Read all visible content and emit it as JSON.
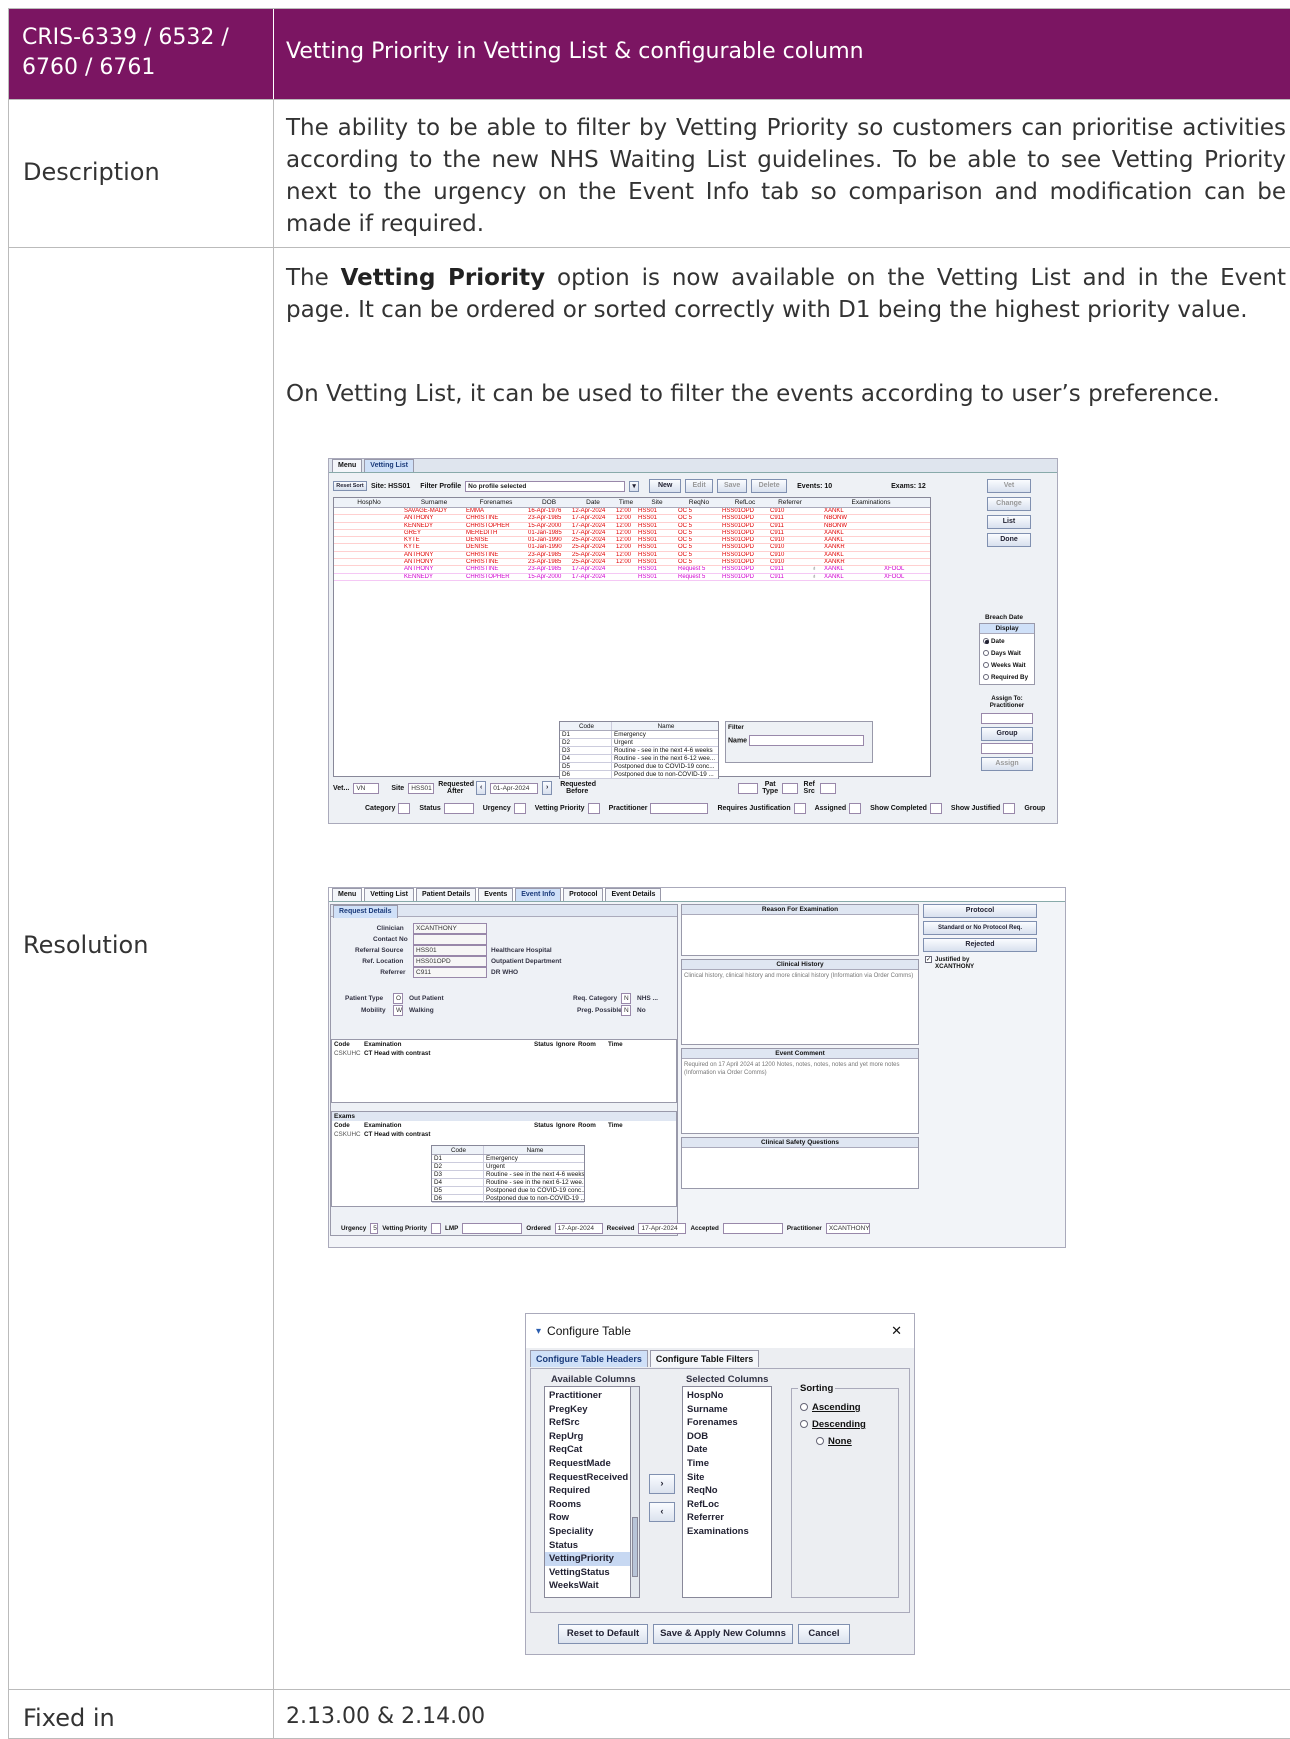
{
  "header": {
    "id": "CRIS-6339 / 6532 / 6760 / 6761",
    "title": "Vetting Priority in Vetting List & configurable column"
  },
  "description": {
    "label": "Description",
    "text": "The ability to be able to filter by Vetting Priority so customers can prioritise activities according to the new NHS Waiting List guidelines. To be able to see Vetting Priority next to the urgency on the Event Info tab so comparison and modification can be made if required."
  },
  "resolution": {
    "label": "Resolution",
    "p1_pre": "The ",
    "p1_bold": "Vetting Priority",
    "p1_post": " option is now available on the Vetting List and in the Event page. It can be ordered or sorted correctly with D1 being the highest priority value.",
    "p2": "On Vetting List, it can be used to filter the events according to user’s preference."
  },
  "fixed": {
    "label": "Fixed in",
    "value": "2.13.00 & 2.14.00"
  },
  "vetting_screen": {
    "tabs": [
      "Menu",
      "Vetting List"
    ],
    "reset_sort": "Reset Sort",
    "site_label": "Site: HSS01",
    "filter_profile_label": "Filter Profile",
    "filter_profile_value": "No profile selected",
    "buttons": [
      "New",
      "Edit",
      "Save",
      "Delete"
    ],
    "events": "Events: 10",
    "exams": "Exams: 12",
    "side_buttons": [
      "Vet",
      "Change",
      "List",
      "Done"
    ],
    "columns": [
      "HospNo",
      "Surname",
      "Forenames",
      "DOB",
      "Date",
      "Time",
      "Site",
      "ReqNo",
      "RefLoc",
      "Referrer",
      "Examinations"
    ],
    "rows": [
      [
        "",
        "SAVAGE-MADY",
        "EMMA",
        "16-Apr-1976",
        "12-Apr-2024",
        "12:00",
        "HSS01",
        "OC 5",
        "HSS01OPD",
        "C910",
        "",
        "XANKL",
        "",
        "r"
      ],
      [
        "",
        "ANTHONY",
        "CHRISTINE",
        "23-Apr-1985",
        "17-Apr-2024",
        "12:00",
        "HSS01",
        "OC 5",
        "HSS01OPD",
        "C911",
        "",
        "NBONW",
        "",
        "r"
      ],
      [
        "",
        "KENNEDY",
        "CHRISTOPHER",
        "15-Apr-2000",
        "17-Apr-2024",
        "12:00",
        "HSS01",
        "OC 5",
        "HSS01OPD",
        "C911",
        "",
        "NBONW",
        "",
        "r"
      ],
      [
        "",
        "GREY",
        "MEREDITH",
        "01-Jan-1985",
        "17-Apr-2024",
        "12:00",
        "HSS01",
        "OC 5",
        "HSS01OPD",
        "C911",
        "",
        "XANKL",
        "",
        "r"
      ],
      [
        "",
        "KYTE",
        "DENISE",
        "01-Jan-1990",
        "25-Apr-2024",
        "12:00",
        "HSS01",
        "OC 5",
        "HSS01OPD",
        "C910",
        "",
        "XANKL",
        "",
        "r"
      ],
      [
        "",
        "KYTE",
        "DENISE",
        "01-Jan-1990",
        "25-Apr-2024",
        "12:00",
        "HSS01",
        "OC 5",
        "HSS01OPD",
        "C910",
        "",
        "XANKR",
        "",
        "r"
      ],
      [
        "",
        "ANTHONY",
        "CHRISTINE",
        "23-Apr-1985",
        "25-Apr-2024",
        "12:00",
        "HSS01",
        "OC 5",
        "HSS01OPD",
        "C910",
        "",
        "XANKL",
        "",
        "r"
      ],
      [
        "",
        "ANTHONY",
        "CHRISTINE",
        "23-Apr-1985",
        "25-Apr-2024",
        "12:00",
        "HSS01",
        "OC 5",
        "HSS01OPD",
        "C910",
        "",
        "XANKR",
        "",
        "r"
      ],
      [
        "",
        "ANTHONY",
        "CHRISTINE",
        "23-Apr-1985",
        "17-Apr-2024",
        "",
        "HSS01",
        "Request 5",
        "HSS01OPD",
        "C911",
        "♁",
        "XANKL",
        "XFOOL",
        "m"
      ],
      [
        "",
        "KENNEDY",
        "CHRISTOPHER",
        "15-Apr-2000",
        "17-Apr-2024",
        "",
        "HSS01",
        "Request 5",
        "HSS01OPD",
        "C911",
        "♁",
        "XANKL",
        "XFOOL",
        "m"
      ]
    ],
    "breach_date": "Breach Date",
    "display_title": "Display",
    "display_options": [
      "Date",
      "Days Wait",
      "Weeks Wait",
      "Required By"
    ],
    "assign_to": "Assign To: Practitioner",
    "group_btn": "Group",
    "assign_btn": "Assign",
    "lookup_headers": [
      "Code",
      "Name"
    ],
    "lookup_rows": [
      [
        "D1",
        "Emergency"
      ],
      [
        "D2",
        "Urgent"
      ],
      [
        "D3",
        "Routine - see in the next 4-6 weeks"
      ],
      [
        "D4",
        "Routine - see in the next 6-12 wee..."
      ],
      [
        "D5",
        "Postponed due to COVID-19 conc..."
      ],
      [
        "D6",
        "Postponed due to non-COVID-19 ..."
      ]
    ],
    "filter_title": "Filter",
    "filter_name": "Name",
    "vet_label": "Vet...",
    "vet_value": "VN",
    "site2_label": "Site",
    "site2_value": "HSS01",
    "req_after": "Requested After",
    "req_after_value": "01-Apr-2024",
    "req_before": "Requested Before",
    "pat_type": "Pat Type",
    "ref_src": "Ref Src",
    "filters_row": [
      "Category",
      "Status",
      "Urgency",
      "Vetting Priority",
      "Practitioner",
      "Requires Justification",
      "Assigned",
      "Show Completed",
      "Show Justified",
      "Group"
    ]
  },
  "event_screen": {
    "tabs": [
      "Menu",
      "Vetting List",
      "Patient Details",
      "Events",
      "Event Info",
      "Protocol",
      "Event Details"
    ],
    "sub_tab": "Request Details",
    "fields": [
      {
        "label": "Clinician",
        "value": "XCANTHONY",
        "extra": ""
      },
      {
        "label": "Contact No",
        "value": "",
        "extra": ""
      },
      {
        "label": "Referral Source",
        "value": "HSS01",
        "extra": "Healthcare Hospital"
      },
      {
        "label": "Ref. Location",
        "value": "HSS01OPD",
        "extra": "Outpatient Department"
      },
      {
        "label": "Referrer",
        "value": "C911",
        "extra": "DR WHO"
      }
    ],
    "patient_type_label": "Patient Type",
    "patient_type_code": "O",
    "patient_type_value": "Out Patient",
    "mobility_label": "Mobility",
    "mobility_code": "W",
    "mobility_value": "Walking",
    "req_category_label": "Req. Category",
    "req_category_code": "N",
    "req_category_value": "NHS ...",
    "preg_label": "Preg. Possible",
    "preg_code": "N",
    "preg_value": "No",
    "exam_headers": [
      "Code",
      "Examination",
      "Status",
      "Ignore",
      "Room",
      "Time"
    ],
    "exam_row": [
      "CSKUHC",
      "CT Head with contrast"
    ],
    "exams_title": "Exams",
    "reason_title": "Reason For Examination",
    "clinical_history_title": "Clinical History",
    "clinical_history_text": "Clinical history, clinical history and more clinical history (Information via Order Comms)",
    "event_comment_title": "Event Comment",
    "event_comment_text": "Required on 17 April 2024 at 1200 Notes, notes, notes, notes and yet more notes (Information via Order Comms)",
    "safety_title": "Clinical Safety Questions",
    "side_buttons": [
      "Protocol",
      "Standard or No Protocol Req.",
      "Rejected"
    ],
    "justified": "Justified by XCANTHONY",
    "bottom": {
      "urgency_label": "Urgency",
      "urgency_value": "5",
      "vp_label": "Vetting Priority",
      "lmp_label": "LMP",
      "ordered_label": "Ordered",
      "ordered_value": "17-Apr-2024",
      "received_label": "Received",
      "received_value": "17-Apr-2024",
      "accepted_label": "Accepted",
      "practitioner_label": "Practitioner",
      "practitioner_value": "XCANTHONY"
    }
  },
  "config_dialog": {
    "title": "Configure Table",
    "tabs": [
      "Configure Table Headers",
      "Configure Table Filters"
    ],
    "available_title": "Available Columns",
    "selected_title": "Selected Columns",
    "available": [
      "Practitioner",
      "PregKey",
      "RefSrc",
      "RepUrg",
      "ReqCat",
      "RequestMade",
      "RequestReceived",
      "Required",
      "Rooms",
      "Row",
      "Speciality",
      "Status",
      "VettingPriority",
      "VettingStatus",
      "WeeksWait"
    ],
    "available_selected": "VettingPriority",
    "selected": [
      "HospNo",
      "Surname",
      "Forenames",
      "DOB",
      "Date",
      "Time",
      "Site",
      "ReqNo",
      "RefLoc",
      "Referrer",
      "Examinations"
    ],
    "sorting_title": "Sorting",
    "sorting": [
      "Ascending",
      "Descending",
      "None"
    ],
    "buttons": [
      "Reset to Default",
      "Save & Apply New Columns",
      "Cancel"
    ],
    "move_right": "›",
    "move_left": "‹",
    "close": "✕",
    "collapse_icon": "chevron-down-icon"
  },
  "colors": {
    "header_bg": "#7b1562",
    "red_row": "#e00000",
    "magenta_row": "#d000d0"
  }
}
